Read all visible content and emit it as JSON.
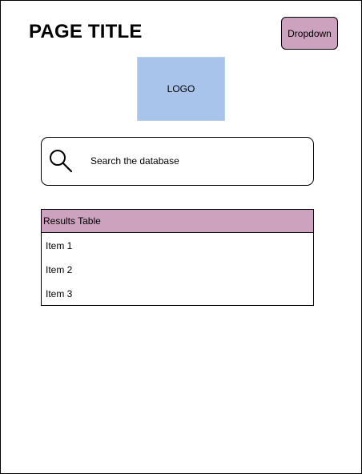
{
  "header": {
    "title": "PAGE TITLE",
    "dropdown_label": "Dropdown"
  },
  "logo": {
    "label": "LOGO"
  },
  "search": {
    "placeholder": "Search the database",
    "icon": "search-icon"
  },
  "results": {
    "header": "Results Table",
    "items": [
      {
        "label": "Item 1"
      },
      {
        "label": "Item 2"
      },
      {
        "label": "Item 3"
      }
    ]
  },
  "colors": {
    "accent": "#cda2bf",
    "logo_fill": "#a9c4eb",
    "border": "#000000",
    "background": "#ffffff"
  }
}
